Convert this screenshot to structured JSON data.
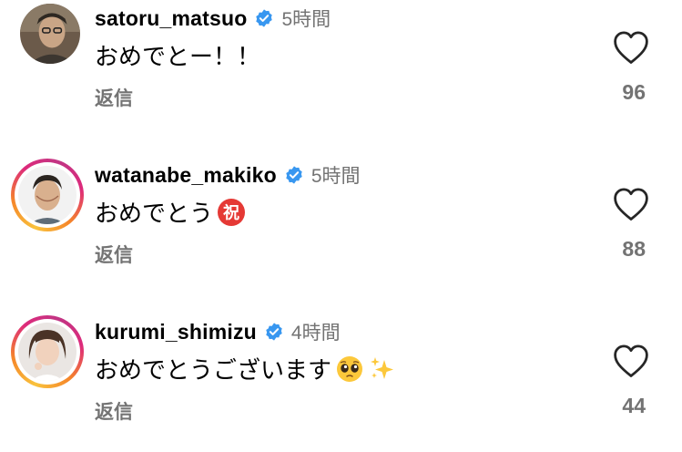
{
  "comments": [
    {
      "username": "satoru_matsuo",
      "time": "5時間",
      "text": "おめでとー！！",
      "reply_label": "返信",
      "likes": "96",
      "verified": true,
      "story_ring": false
    },
    {
      "username": "watanabe_makiko",
      "time": "5時間",
      "text": "おめでとう",
      "text_emoji": "祝",
      "reply_label": "返信",
      "likes": "88",
      "verified": true,
      "story_ring": true
    },
    {
      "username": "kurumi_shimizu",
      "time": "4時間",
      "text": "おめでとうございます",
      "reply_label": "返信",
      "likes": "44",
      "verified": true,
      "story_ring": true
    }
  ],
  "icons": {
    "verified": "verified-badge-icon",
    "like": "heart-outline-icon",
    "emoji_congrats": "congratulations-emoji-icon",
    "emoji_pleading": "pleading-face-emoji-icon",
    "emoji_sparkles": "sparkles-emoji-icon"
  },
  "colors": {
    "verified_blue": "#3897f0",
    "secondary_text": "#737373",
    "congrats_red": "#e53935"
  }
}
